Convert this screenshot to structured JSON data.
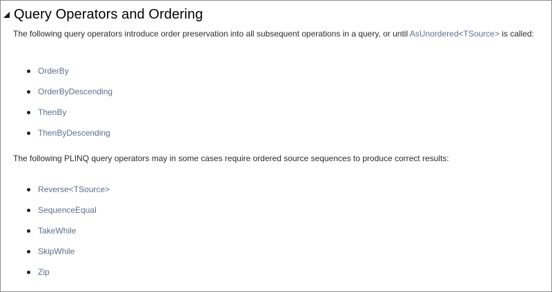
{
  "section": {
    "title": "Query Operators and Ordering",
    "icon": "collapse-triangle-icon"
  },
  "intro": {
    "text_before": "The following query operators introduce order preservation into all subsequent operations in a query, or until ",
    "link": "AsUnordered<TSource>",
    "text_after": " is called:"
  },
  "ordering_operators": [
    "OrderBy",
    "OrderByDescending",
    "ThenBy",
    "ThenByDescending"
  ],
  "plinq_paragraph": "The following PLINQ query operators may in some cases require ordered source sequences to produce correct results:",
  "plinq_operators": [
    "Reverse<TSource>",
    "SequenceEqual",
    "TakeWhile",
    "SkipWhile",
    "Zip"
  ],
  "colors": {
    "link": "#5b6f8c",
    "text": "#2a2a2a",
    "title": "#000000",
    "border": "#8c8c8c"
  }
}
